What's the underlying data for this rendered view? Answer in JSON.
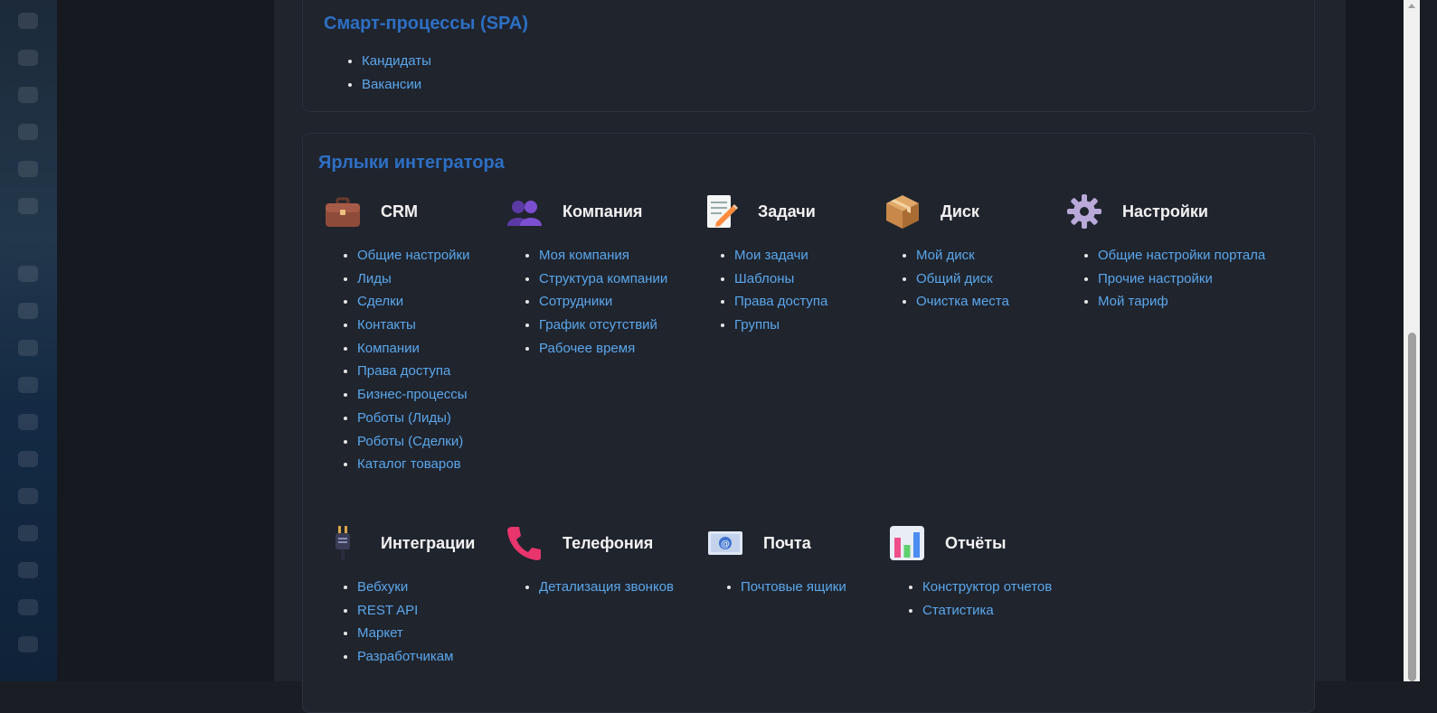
{
  "spa": {
    "title": "Смарт-процессы (SPA)",
    "items": [
      "Кандидаты",
      "Вакансии"
    ]
  },
  "integrator": {
    "title": "Ярлыки интегратора",
    "groups": [
      {
        "title": "CRM",
        "icon": "briefcase-icon",
        "items": [
          "Общие настройки",
          "Лиды",
          "Сделки",
          "Контакты",
          "Компании",
          "Права доступа",
          "Бизнес-процессы",
          "Роботы (Лиды)",
          "Роботы (Сделки)",
          "Каталог товаров"
        ]
      },
      {
        "title": "Компания",
        "icon": "people-icon",
        "items": [
          "Моя компания",
          "Структура компании",
          "Сотрудники",
          "График отсутствий",
          "Рабочее время"
        ]
      },
      {
        "title": "Задачи",
        "icon": "memo-pencil-icon",
        "items": [
          "Мои задачи",
          "Шаблоны",
          "Права доступа",
          "Группы"
        ]
      },
      {
        "title": "Диск",
        "icon": "package-icon",
        "items": [
          "Мой диск",
          "Общий диск",
          "Очистка места"
        ]
      },
      {
        "title": "Настройки",
        "icon": "gear-icon",
        "items": [
          "Общие настройки портала",
          "Прочие настройки",
          "Мой тариф"
        ]
      },
      {
        "title": "Интеграции",
        "icon": "plug-icon",
        "items": [
          "Вебхуки",
          "REST API",
          "Маркет",
          "Разработчикам"
        ]
      },
      {
        "title": "Телефония",
        "icon": "phone-icon",
        "items": [
          "Детализация звонков"
        ]
      },
      {
        "title": "Почта",
        "icon": "email-icon",
        "items": [
          "Почтовые ящики"
        ]
      },
      {
        "title": "Отчёты",
        "icon": "bar-chart-icon",
        "items": [
          "Конструктор отчетов",
          "Статистика"
        ]
      }
    ]
  },
  "colors": {
    "accent": "#2d6fc4",
    "link": "#5aa7ec",
    "background": "#20242d"
  }
}
